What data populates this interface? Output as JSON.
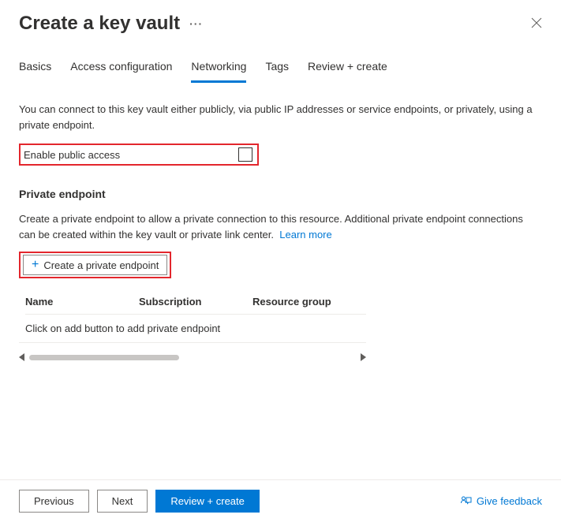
{
  "header": {
    "title": "Create a key vault"
  },
  "tabs": {
    "items": [
      {
        "label": "Basics"
      },
      {
        "label": "Access configuration"
      },
      {
        "label": "Networking"
      },
      {
        "label": "Tags"
      },
      {
        "label": "Review + create"
      }
    ],
    "active_index": 2
  },
  "networking": {
    "intro": "You can connect to this key vault either publicly, via public IP addresses or service endpoints, or privately, using a private endpoint.",
    "enable_public_access_label": "Enable public access",
    "enable_public_access_checked": false,
    "section_title": "Private endpoint",
    "section_desc": "Create a private endpoint to allow a private connection to this resource. Additional private endpoint connections can be created within the key vault or private link center.",
    "learn_more": "Learn more",
    "create_button": "Create a private endpoint",
    "table": {
      "headers": {
        "name": "Name",
        "subscription": "Subscription",
        "resource_group": "Resource group"
      },
      "empty_text": "Click on add button to add private endpoint"
    }
  },
  "footer": {
    "previous": "Previous",
    "next": "Next",
    "review": "Review + create",
    "feedback": "Give feedback"
  }
}
